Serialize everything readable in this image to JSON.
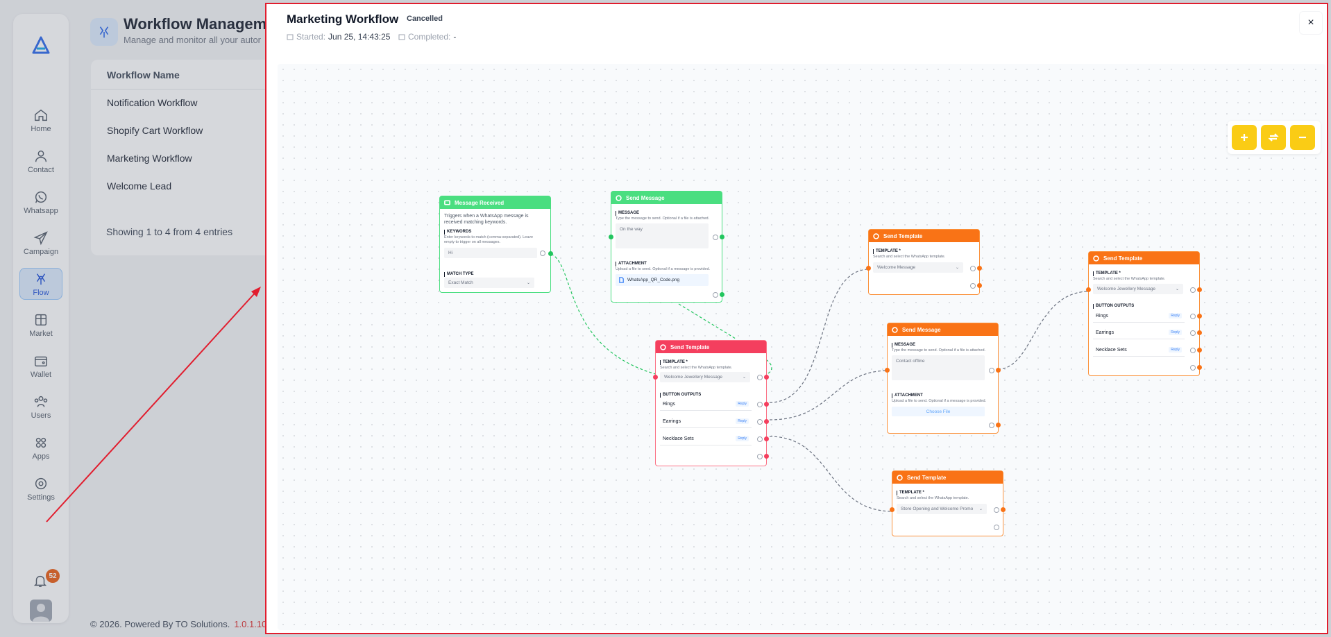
{
  "sidebar": {
    "items": [
      {
        "label": "Home",
        "icon": "home-icon"
      },
      {
        "label": "Contact",
        "icon": "user-icon"
      },
      {
        "label": "Whatsapp",
        "icon": "whatsapp-icon"
      },
      {
        "label": "Campaign",
        "icon": "send-icon"
      },
      {
        "label": "Flow",
        "icon": "flow-icon"
      },
      {
        "label": "Market",
        "icon": "store-icon"
      },
      {
        "label": "Wallet",
        "icon": "wallet-icon"
      },
      {
        "label": "Users",
        "icon": "users-icon"
      },
      {
        "label": "Apps",
        "icon": "apps-icon"
      },
      {
        "label": "Settings",
        "icon": "settings-icon"
      }
    ],
    "active": "Flow",
    "notification_count": "52"
  },
  "page": {
    "title": "Workflow Managemen",
    "subtitle": "Manage and monitor all your autor",
    "column_header": "Workflow Name",
    "rows": [
      "Notification Workflow",
      "Shopify Cart Workflow",
      "Marketing Workflow",
      "Welcome Lead"
    ],
    "entries": "Showing 1 to 4 from 4 entries",
    "footer": "© 2026. Powered By TO Solutions.",
    "version": "1.0.1.10"
  },
  "modal": {
    "title": "Marketing Workflow",
    "status": "Cancelled",
    "started_label": "Started:",
    "started_value": "Jun 25, 14:43:25",
    "completed_label": "Completed:",
    "completed_value": "-",
    "close": "×"
  },
  "nodes": {
    "message_received": {
      "title": "Message Received",
      "desc": "Triggers when a WhatsApp message is received matching keywords.",
      "keywords_label": "KEYWORDS",
      "keywords_hint": "Enter keywords to match (comma-separated). Leave empty to trigger on all messages.",
      "keywords_value": "Hi",
      "match_label": "MATCH TYPE",
      "match_value": "Exact Match"
    },
    "send_message_1": {
      "title": "Send Message",
      "message_label": "MESSAGE",
      "message_hint": "Type the message to send. Optional if a file is attached.",
      "message_value": "On the way",
      "attachment_label": "ATTACHMENT",
      "attachment_hint": "Upload a file to send. Optional if a message is provided.",
      "file_name": "WhatsApp_QR_Code.png"
    },
    "send_template_pink": {
      "title": "Send Template",
      "template_label": "TEMPLATE *",
      "template_hint": "Search and select the WhatsApp template.",
      "template_value": "Welcome Jewellery Message",
      "outputs_label": "BUTTON OUTPUTS",
      "outputs": [
        "Rings",
        "Earrings",
        "Necklace Sets"
      ],
      "reply": "Reply"
    },
    "send_template_top": {
      "title": "Send Template",
      "template_label": "TEMPLATE *",
      "template_hint": "Search and select the WhatsApp template.",
      "template_value": "Welcome Message"
    },
    "send_message_2": {
      "title": "Send Message",
      "message_label": "MESSAGE",
      "message_hint": "Type the message to send. Optional if a file is attached.",
      "message_value": "Contact offline",
      "attachment_label": "ATTACHMENT",
      "attachment_hint": "Upload a file to send. Optional if a message is provided.",
      "choose_file": "Choose File"
    },
    "send_template_bottom": {
      "title": "Send Template",
      "template_label": "TEMPLATE *",
      "template_hint": "Search and select the WhatsApp template.",
      "template_value": "Store Opening and Welcome Promo"
    },
    "send_template_right": {
      "title": "Send Template",
      "template_label": "TEMPLATE *",
      "template_hint": "Search and select the WhatsApp template.",
      "template_value": "Welcome Jewellery Message",
      "outputs_label": "BUTTON OUTPUTS",
      "outputs": [
        "Rings",
        "Earrings",
        "Necklace Sets"
      ],
      "reply": "Reply"
    }
  },
  "colors": {
    "accent": "#facc15",
    "green": "#4ade80",
    "orange": "#f97316",
    "pink": "#f43f5e",
    "highlight": "#e11d2e"
  }
}
